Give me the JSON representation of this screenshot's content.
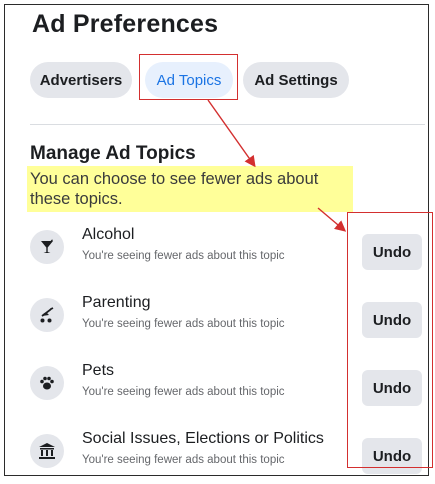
{
  "page": {
    "title": "Ad Preferences",
    "tabs": [
      {
        "label": "Advertisers",
        "active": false
      },
      {
        "label": "Ad Topics",
        "active": true
      },
      {
        "label": "Ad Settings",
        "active": false
      }
    ],
    "section_title": "Manage Ad Topics",
    "description": "You can choose to see fewer ads about these topics."
  },
  "topics": [
    {
      "name": "Alcohol",
      "status": "You're seeing fewer ads about this topic",
      "icon": "cocktail-icon",
      "action": "Undo"
    },
    {
      "name": "Parenting",
      "status": "You're seeing fewer ads about this topic",
      "icon": "stroller-icon",
      "action": "Undo"
    },
    {
      "name": "Pets",
      "status": "You're seeing fewer ads about this topic",
      "icon": "paw-icon",
      "action": "Undo"
    },
    {
      "name": "Social Issues, Elections or Politics",
      "status": "You're seeing fewer ads about this topic",
      "icon": "government-building-icon",
      "action": "Undo"
    }
  ],
  "colors": {
    "accent": "#1b74e4",
    "highlight_yellow": "#ffff99",
    "annotation_red": "#d32f2f"
  }
}
